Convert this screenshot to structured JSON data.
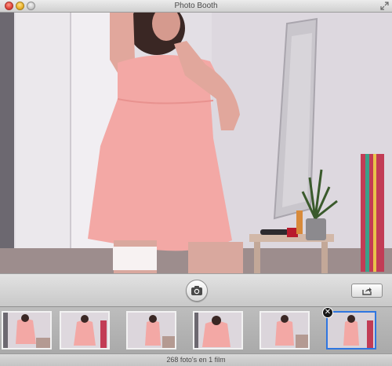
{
  "window": {
    "title": "Photo Booth"
  },
  "controls": {
    "take_photo_icon": "camera-icon",
    "share_icon": "share-icon"
  },
  "filmstrip": {
    "thumbnails": [
      {
        "selected": false
      },
      {
        "selected": false
      },
      {
        "selected": false
      },
      {
        "selected": false
      },
      {
        "selected": false
      },
      {
        "selected": true
      }
    ],
    "remove_icon": "close-icon"
  },
  "status": {
    "text": "268 foto's en 1 film"
  },
  "colors": {
    "selection": "#2f76e0"
  }
}
